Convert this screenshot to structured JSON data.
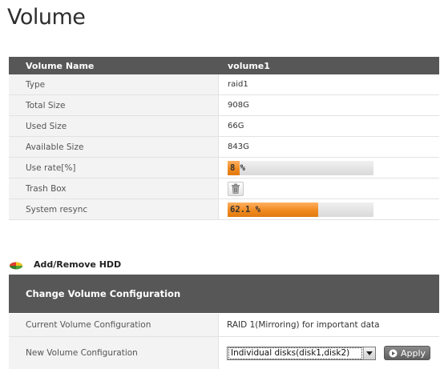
{
  "page": {
    "title": "Volume"
  },
  "volume_table": {
    "header": {
      "name_label": "Volume Name",
      "name_value": "volume1"
    },
    "rows": [
      {
        "label": "Type",
        "value": "raid1"
      },
      {
        "label": "Total Size",
        "value": "908G"
      },
      {
        "label": "Used Size",
        "value": "66G"
      },
      {
        "label": "Available Size",
        "value": "843G"
      }
    ],
    "use_rate": {
      "label": "Use rate[%]",
      "text": "8 %",
      "percent": 8
    },
    "trash": {
      "label": "Trash Box",
      "icon": "trash-icon"
    },
    "resync": {
      "label": "System resync",
      "text": "62.1 %",
      "percent": 62.1
    }
  },
  "hdd_section": {
    "title": "Add/Remove HDD",
    "icon": "pie-chart-icon"
  },
  "config": {
    "header": "Change Volume Configuration",
    "current_label": "Current Volume Configuration",
    "current_value": "RAID 1(Mirroring) for important data",
    "new_label": "New Volume Configuration",
    "new_value": "Individual disks(disk1,disk2)",
    "apply_label": "Apply"
  },
  "colors": {
    "header_bg": "#575757",
    "progress_fill": "#f08a20",
    "row_label_bg": "#f3f3f3"
  }
}
